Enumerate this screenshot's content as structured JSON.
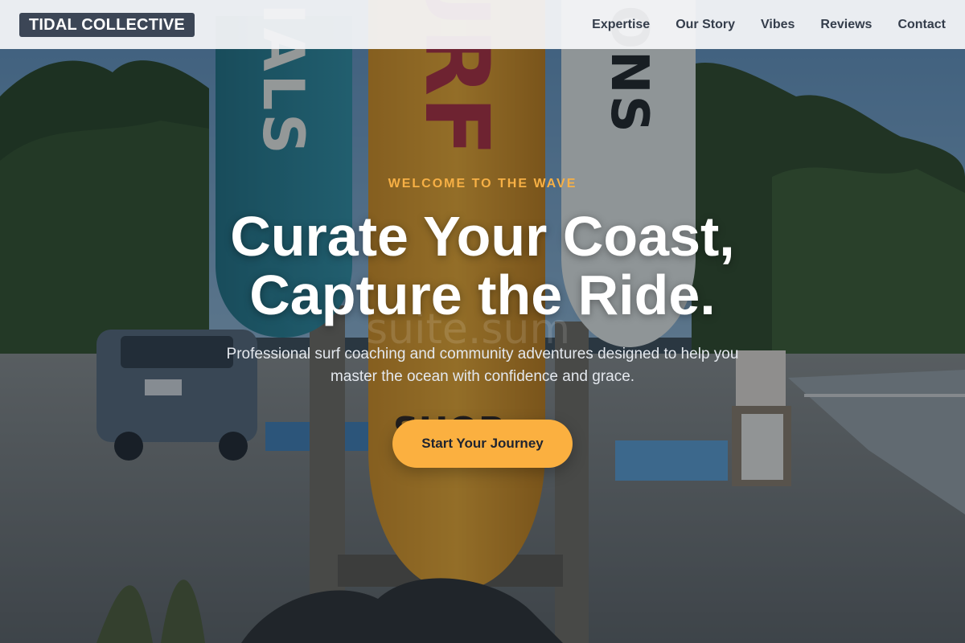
{
  "brand": {
    "logo_text": "TIDAL COLLECTIVE"
  },
  "nav": {
    "items": [
      {
        "label": "Expertise"
      },
      {
        "label": "Our Story"
      },
      {
        "label": "Vibes"
      },
      {
        "label": "Reviews"
      },
      {
        "label": "Contact"
      }
    ]
  },
  "hero": {
    "eyebrow": "WELCOME TO THE WAVE",
    "headline_line1": "Curate Your Coast,",
    "headline_line2": "Capture the Ride.",
    "subtitle": "Professional surf coaching and community adventures designed to help you master the ocean with confidence and grace.",
    "cta_label": "Start Your Journey",
    "watermark_text": "suite.sum",
    "background": {
      "sign_left_letters": "IALS",
      "sign_center_letters": "URF",
      "sign_center_lower": "SHOP",
      "sign_right_letters": "SSONS"
    }
  },
  "colors": {
    "accent": "#fbb040",
    "eyebrow": "#f7b045",
    "logo_bg": "#3c4656",
    "nav_text": "#343d4b"
  }
}
